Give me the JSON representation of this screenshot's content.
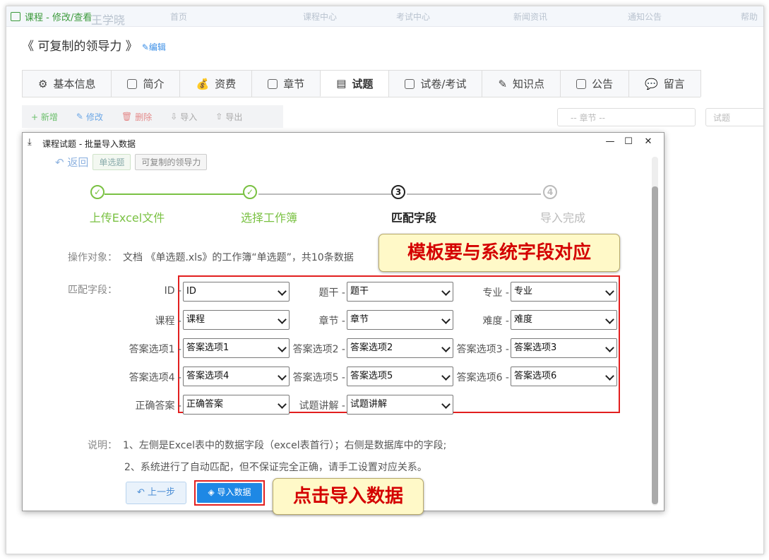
{
  "topbar": {
    "title": "课程 - 修改/查看",
    "ghost_items": [
      "王学晓",
      "首页",
      "课程中心",
      "考试中心",
      "新闻资讯",
      "通知公告",
      "帮助"
    ]
  },
  "course": {
    "title": "《 可复制的领导力 》",
    "edit_label": "编辑"
  },
  "tabs": [
    {
      "label": "基本信息",
      "icon": "gear-icon"
    },
    {
      "label": "简介",
      "icon": "doc-icon"
    },
    {
      "label": "资费",
      "icon": "money-bag-icon"
    },
    {
      "label": "章节",
      "icon": "chapter-icon"
    },
    {
      "label": "试题",
      "icon": "list-icon"
    },
    {
      "label": "试卷/考试",
      "icon": "paper-icon"
    },
    {
      "label": "知识点",
      "icon": "pen-doc-icon"
    },
    {
      "label": "公告",
      "icon": "notice-icon"
    },
    {
      "label": "留言",
      "icon": "comment-icon"
    }
  ],
  "toolbar": {
    "add": "+ 新增",
    "edit": "修改",
    "delete": "删除",
    "import": "导入",
    "export": "导出"
  },
  "filters": {
    "chapter_placeholder": "-- 章节 --",
    "search_placeholder": "试题"
  },
  "dialog": {
    "title": "课程试题 - 批量导入数据",
    "back_label": "返回",
    "chip_type": "单选题",
    "chip_course": "可复制的领导力",
    "steps": [
      {
        "label": "上传Excel文件",
        "mark": "✓"
      },
      {
        "label": "选择工作簿",
        "mark": "✓"
      },
      {
        "label": "匹配字段",
        "mark": "3"
      },
      {
        "label": "导入完成",
        "mark": "4"
      }
    ],
    "target_label": "操作对象：",
    "target_text": "文档 《单选题.xls》的工作簿“单选题”，共10条数据",
    "match_label": "匹配字段：",
    "fields": [
      {
        "label": "ID -",
        "value": "ID"
      },
      {
        "label": "题干 -",
        "value": "题干"
      },
      {
        "label": "专业 -",
        "value": "专业"
      },
      {
        "label": "课程 -",
        "value": "课程"
      },
      {
        "label": "章节 -",
        "value": "章节"
      },
      {
        "label": "难度 -",
        "value": "难度"
      },
      {
        "label": "答案选项1 -",
        "value": "答案选项1"
      },
      {
        "label": "答案选项2 -",
        "value": "答案选项2"
      },
      {
        "label": "答案选项3 -",
        "value": "答案选项3"
      },
      {
        "label": "答案选项4 -",
        "value": "答案选项4"
      },
      {
        "label": "答案选项5 -",
        "value": "答案选项5"
      },
      {
        "label": "答案选项6 -",
        "value": "答案选项6"
      },
      {
        "label": "正确答案 -",
        "value": "正确答案"
      },
      {
        "label": "试题讲解 -",
        "value": "试题讲解"
      }
    ],
    "notes_label": "说明：",
    "note1": "1、左侧是Excel表中的数据字段（excel表首行）；右侧是数据库中的字段;",
    "note2": "2、系统进行了自动匹配，但不保证完全正确，请手工设置对应关系。",
    "prev_label": "上一步",
    "import_label": "导入数据"
  },
  "callouts": {
    "template": "模板要与系统字段对应",
    "click_import": "点击导入数据"
  },
  "colors": {
    "green": "#7ac143",
    "blue": "#1e88e5",
    "red": "#e21f1f"
  }
}
